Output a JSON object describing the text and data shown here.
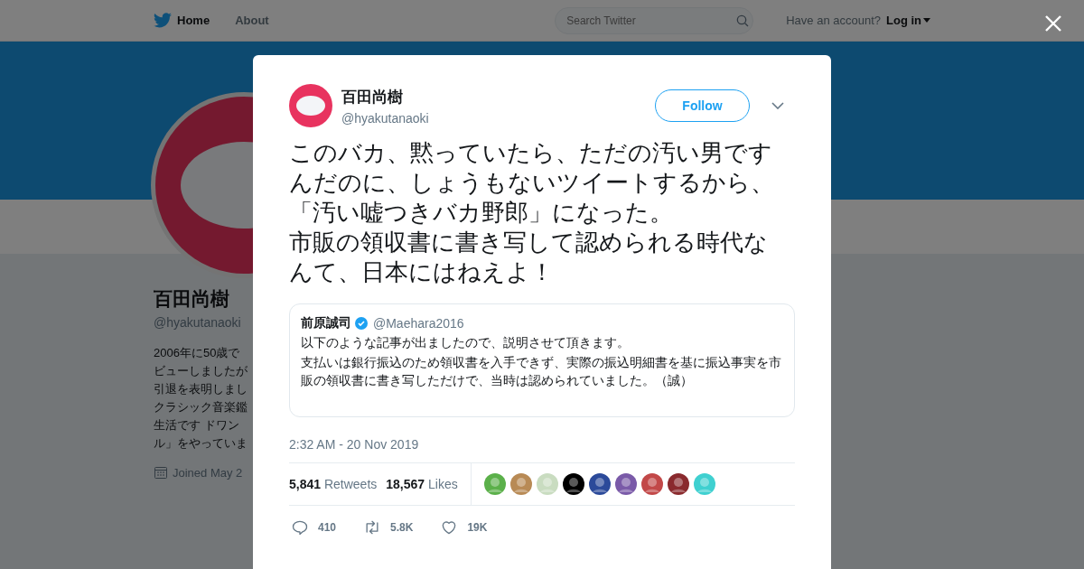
{
  "nav": {
    "items": [
      {
        "label": "Home",
        "selected": true
      },
      {
        "label": "About",
        "selected": false
      }
    ],
    "search": {
      "placeholder": "Search Twitter"
    },
    "account_prompt": "Have an account?",
    "login": "Log in"
  },
  "profile": {
    "name": "百田尚樹",
    "handle": "@hyakutanaoki",
    "bio_lines": [
      "2006年に50歳で",
      "ビューしましたが",
      "引退を表明しまし",
      "クラシック音楽鑑",
      "生活です ドワン",
      "ル」をやっていま"
    ],
    "joined": "Joined May 2"
  },
  "tweet": {
    "name": "百田尚樹",
    "handle": "@hyakutanaoki",
    "follow": "Follow",
    "paragraphs": [
      "このバカ、黙っていたら、ただの汚い男ですんだのに、しょうもないツイートするから、「汚い嘘つきバカ野郎」になった。",
      "市販の領収書に書き写して認められる時代なんて、日本にはねえよ！"
    ],
    "quote": {
      "name": "前原誠司",
      "verified": true,
      "handle": "@Maehara2016",
      "lines": [
        "以下のような記事が出ましたので、説明させて頂きます。",
        "支払いは銀行振込のため領収書を入手できず、実際の振込明細書を基に振込事実を市販の領収書に書き写しただけで、当時は認められていました。（誠）"
      ]
    },
    "timestamp": "2:32 AM - 20 Nov 2019",
    "stats": [
      {
        "count": "5,841",
        "label": "Retweets"
      },
      {
        "count": "18,567",
        "label": "Likes"
      }
    ],
    "likers": [
      {
        "color": "#5bb04a"
      },
      {
        "color": "#b88a55"
      },
      {
        "color": "#c9dcc0"
      },
      {
        "color": "#000000"
      },
      {
        "color": "#2b4a9a"
      },
      {
        "color": "#7a5aa8"
      },
      {
        "color": "#c24848"
      },
      {
        "color": "#8a2a2e"
      },
      {
        "color": "#3fd0d0"
      }
    ],
    "actions": [
      {
        "kind": "reply",
        "count": "410"
      },
      {
        "kind": "retweet",
        "count": "5.8K"
      },
      {
        "kind": "like",
        "count": "19K"
      }
    ]
  }
}
